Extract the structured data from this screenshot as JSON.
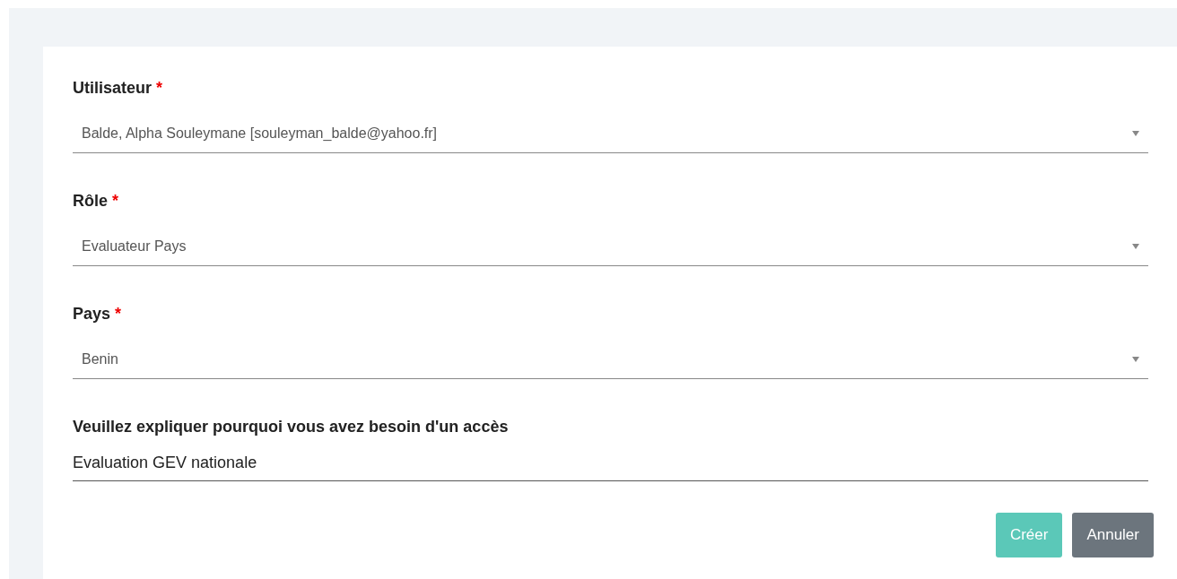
{
  "fields": [
    {
      "kind": "select",
      "label": "Utilisateur",
      "required": true,
      "value": "Balde, Alpha Souleymane [souleyman_balde@yahoo.fr]"
    },
    {
      "kind": "select",
      "label": "Rôle",
      "required": true,
      "value": "Evaluateur Pays"
    },
    {
      "kind": "select",
      "label": "Pays",
      "required": true,
      "value": "Benin"
    },
    {
      "kind": "text",
      "label": "Veuillez expliquer pourquoi vous avez besoin d'un accès",
      "required": false,
      "value": "Evaluation GEV nationale"
    }
  ],
  "required_mark": "*",
  "buttons": [
    {
      "label": "Créer",
      "kind": "primary",
      "disabled": true
    },
    {
      "label": "Annuler",
      "kind": "secondary",
      "disabled": false
    }
  ]
}
